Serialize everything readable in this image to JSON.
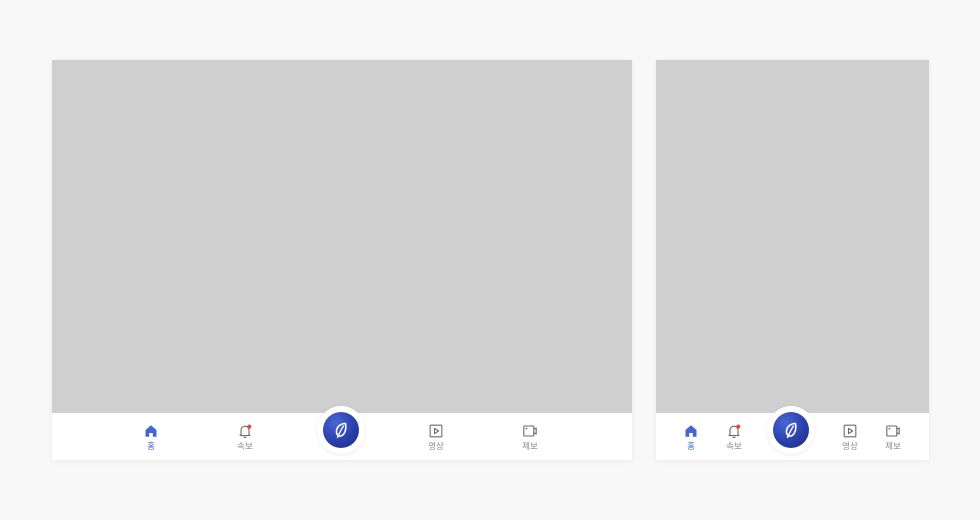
{
  "colors": {
    "accent": "#3b5fcb",
    "inactive": "#8a8a8a",
    "notification_dot": "#e8463a",
    "content_placeholder": "#cfcfcf",
    "fab": "#2a3fa8"
  },
  "tabbar": {
    "home": {
      "label": "홈",
      "icon": "home-icon",
      "active": true
    },
    "alerts": {
      "label": "속보",
      "icon": "bell-icon",
      "has_notification": true
    },
    "center": {
      "icon": "leaf-logo-icon"
    },
    "video": {
      "label": "영상",
      "icon": "play-square-icon"
    },
    "report": {
      "label": "제보",
      "icon": "camera-icon"
    }
  }
}
